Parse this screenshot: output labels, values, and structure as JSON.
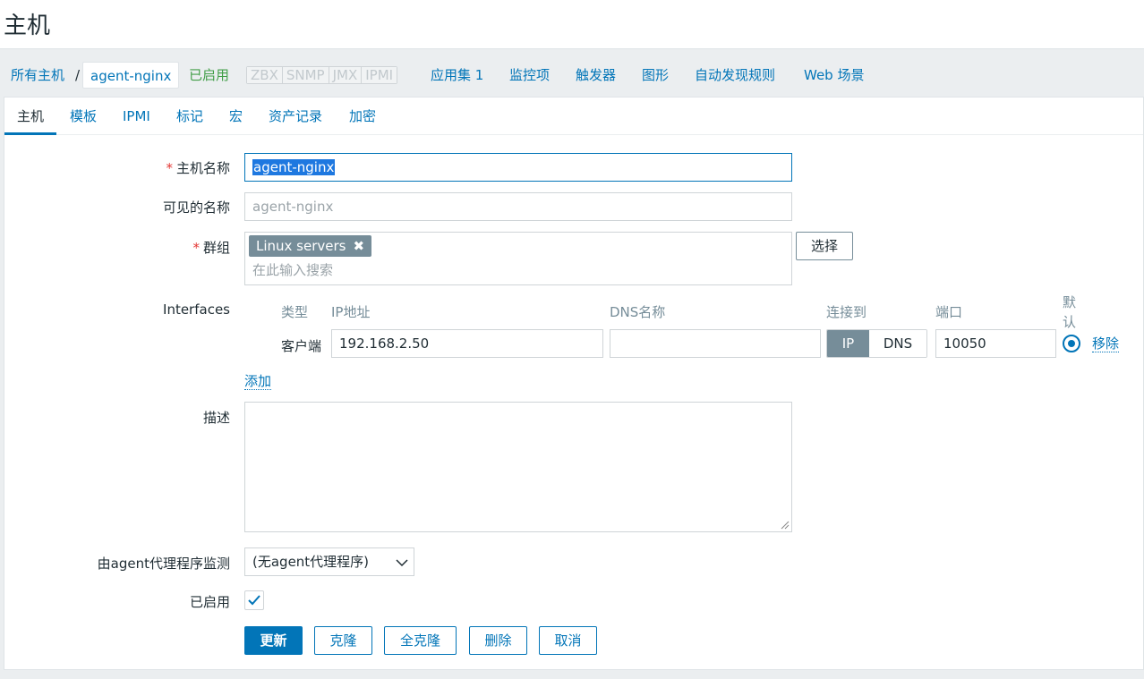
{
  "page": {
    "title": "主机"
  },
  "nav": {
    "all_hosts": "所有主机",
    "separator": "/",
    "current_host": "agent-nginx",
    "status": "已启用",
    "availability": [
      "ZBX",
      "SNMP",
      "JMX",
      "IPMI"
    ],
    "applications": "应用集 1",
    "items": "监控项",
    "triggers": "触发器",
    "graphs": "图形",
    "discovery": "自动发现规则",
    "web": "Web 场景"
  },
  "tabs": [
    "主机",
    "模板",
    "IPMI",
    "标记",
    "宏",
    "资产记录",
    "加密"
  ],
  "form": {
    "host_name": {
      "label": "主机名称",
      "value": "agent-nginx"
    },
    "visible_name": {
      "label": "可见的名称",
      "placeholder": "agent-nginx"
    },
    "groups": {
      "label": "群组",
      "chip": "Linux servers",
      "chip_remove": "✖",
      "search_placeholder": "在此输入搜索",
      "select_button": "选择"
    },
    "interfaces": {
      "label": "Interfaces",
      "headers": {
        "type": "类型",
        "ip": "IP地址",
        "dns": "DNS名称",
        "connect": "连接到",
        "port": "端口",
        "default_1": "默",
        "default_2": "认"
      },
      "row": {
        "type": "客户端",
        "ip": "192.168.2.50",
        "dns": "",
        "connect_ip": "IP",
        "connect_dns": "DNS",
        "port": "10050",
        "remove": "移除"
      },
      "add": "添加"
    },
    "description": {
      "label": "描述",
      "value": ""
    },
    "proxy": {
      "label": "由agent代理程序监测",
      "value": "(无agent代理程序)"
    },
    "enabled": {
      "label": "已启用",
      "checked": true
    }
  },
  "buttons": {
    "update": "更新",
    "clone": "克隆",
    "full_clone": "全克隆",
    "delete": "删除",
    "cancel": "取消"
  },
  "required_mark": "*"
}
